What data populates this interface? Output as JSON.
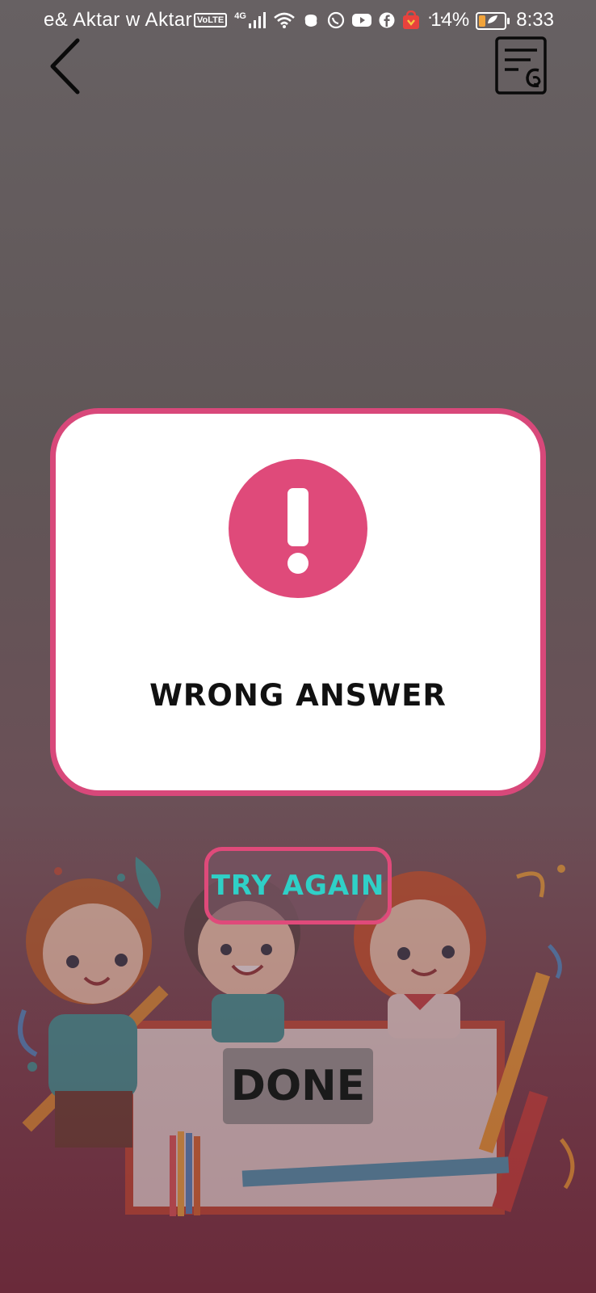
{
  "status_bar": {
    "carrier": "e& Aktar w Aktar",
    "volte": "VoLTE",
    "network": "4G",
    "battery_percent": "14%",
    "battery_level": 0.14,
    "time": "8:33",
    "more": "···",
    "icons": [
      "signal-icon",
      "wifi-icon",
      "app-icon",
      "whatsapp-icon",
      "youtube-icon",
      "facebook-icon",
      "shop-icon"
    ]
  },
  "nav": {
    "back_icon": "chevron-left-icon",
    "report_icon": "report-icon"
  },
  "dialog": {
    "icon": "exclamation-icon",
    "title": "WRONG ANSWER",
    "accent_color": "#df4a7a"
  },
  "buttons": {
    "try_again": "TRY AGAIN",
    "done": "DONE"
  },
  "colors": {
    "try_again_text": "#2fd0c7",
    "border_pink": "#d8487a"
  }
}
